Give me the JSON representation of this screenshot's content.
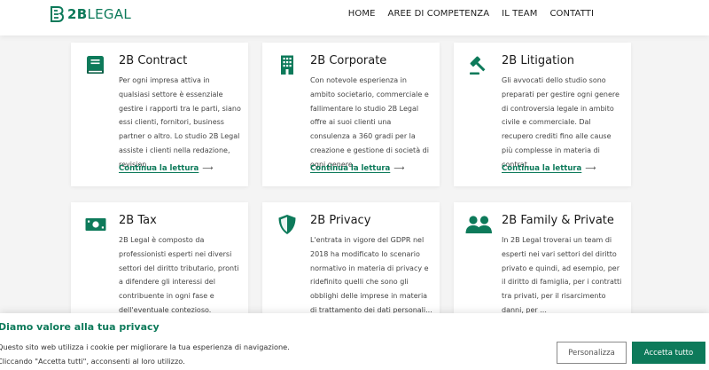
{
  "brand": {
    "logo_bold": "2B",
    "logo_rest": "LEGAL",
    "accent_color": "#0d7a5a"
  },
  "nav": {
    "items": [
      "HOME",
      "AREE DI COMPETENZA",
      "IL TEAM",
      "CONTATTI"
    ]
  },
  "cards": [
    {
      "title": "2B Contract",
      "icon": "contract-book-icon",
      "description": "Per ogni impresa attiva in qualsiasi settore è essenziale gestire i rapporti tra le parti, siano essi clienti, fornitori, business partner o altro. Lo studio 2B Legal assiste i clienti nella redazione, revision...",
      "more": "Continua la lettura",
      "arrow": "⟶"
    },
    {
      "title": "2B Corporate",
      "icon": "building-icon",
      "description": "Con notevole esperienza in ambito societario, commerciale e fallimentare lo studio 2B Legal offre ai suoi clienti una consulenza a 360 gradi per la creazione e gestione di società di ogni genere.",
      "more": "Continua la lettura",
      "arrow": "⟶"
    },
    {
      "title": "2B Litigation",
      "icon": "gavel-icon",
      "description": "Gli avvocati dello studio sono preparati per gestire ogni genere di controversia legale in ambito civile e commerciale. Dal recupero crediti fino alle cause più complesse in materia di contrat...",
      "more": "Continua la lettura",
      "arrow": "⟶"
    },
    {
      "title": "2B Tax",
      "icon": "money-bill-icon",
      "description": "2B Legal è composto da professionisti esperti nei diversi settori del diritto tributario, pronti a difendere gli interessi del contribuente in ogni fase e dell'eventuale contezioso."
    },
    {
      "title": "2B Privacy",
      "icon": "shield-icon",
      "description": "L'entrata in vigore del GDPR nel 2018 ha modificato lo scenario normativo in materia di privacy e ridefinito quelli che sono gli obblighi delle imprese in materia di trattamento dei dati personali..."
    },
    {
      "title": "2B Family & Private",
      "icon": "users-icon",
      "description": "In 2B Legal troverai un team di esperti nei vari settori del diritto privato e quindi, ad esempio, per il diritto di famiglia, per i contratti tra privati, per il risarcimento danni, per ..."
    }
  ],
  "cookie": {
    "title": "Diamo valore alla tua privacy",
    "line1": "Questo sito web utilizza i cookie per migliorare la tua esperienza di navigazione.",
    "line2": "Cliccando \"Accetta tutti\", acconsenti al loro utilizzo.",
    "customize_label": "Personalizza",
    "accept_label": "Accetta tutto"
  }
}
